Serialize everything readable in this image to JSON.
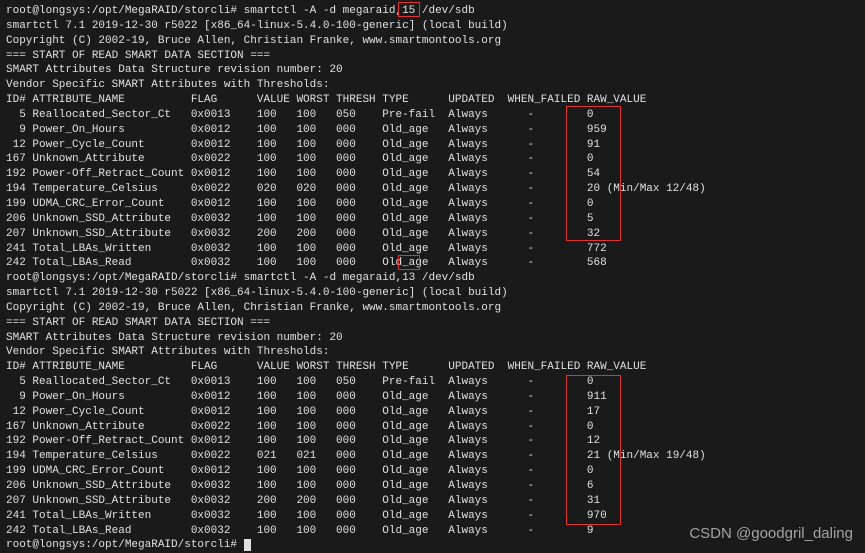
{
  "block1": {
    "cmd_prompt": "root@longsys:/opt/MegaRAID/storcli# ",
    "cmd": "smartctl -A -d megaraid,15 /dev/sdb",
    "version": "smartctl 7.1 2019-12-30 r5022 [x86_64-linux-5.4.0-100-generic] (local build)",
    "copyright": "Copyright (C) 2002-19, Bruce Allen, Christian Franke, www.smartmontools.org",
    "section_hdr": "=== START OF READ SMART DATA SECTION ===",
    "rev": "SMART Attributes Data Structure revision number: 20",
    "vendor": "Vendor Specific SMART Attributes with Thresholds:",
    "columns": {
      "id": "ID#",
      "attr": "ATTRIBUTE_NAME",
      "flag": "FLAG",
      "value": "VALUE",
      "worst": "WORST",
      "thresh": "THRESH",
      "type": "TYPE",
      "updated": "UPDATED",
      "when": "WHEN_FAILED",
      "raw": "RAW_VALUE"
    },
    "rows": [
      {
        "id": "  5",
        "name": "Reallocated_Sector_Ct",
        "flag": "0x0013",
        "value": "100",
        "worst": "100",
        "thresh": "050",
        "type": "Pre-fail",
        "updated": "Always",
        "when": "-",
        "raw": "0"
      },
      {
        "id": "  9",
        "name": "Power_On_Hours",
        "flag": "0x0012",
        "value": "100",
        "worst": "100",
        "thresh": "000",
        "type": "Old_age",
        "updated": "Always",
        "when": "-",
        "raw": "959"
      },
      {
        "id": " 12",
        "name": "Power_Cycle_Count",
        "flag": "0x0012",
        "value": "100",
        "worst": "100",
        "thresh": "000",
        "type": "Old_age",
        "updated": "Always",
        "when": "-",
        "raw": "91"
      },
      {
        "id": "167",
        "name": "Unknown_Attribute",
        "flag": "0x0022",
        "value": "100",
        "worst": "100",
        "thresh": "000",
        "type": "Old_age",
        "updated": "Always",
        "when": "-",
        "raw": "0"
      },
      {
        "id": "192",
        "name": "Power-Off_Retract_Count",
        "flag": "0x0012",
        "value": "100",
        "worst": "100",
        "thresh": "000",
        "type": "Old_age",
        "updated": "Always",
        "when": "-",
        "raw": "54"
      },
      {
        "id": "194",
        "name": "Temperature_Celsius",
        "flag": "0x0022",
        "value": "020",
        "worst": "020",
        "thresh": "000",
        "type": "Old_age",
        "updated": "Always",
        "when": "-",
        "raw": "20 (Min/Max 12/48)"
      },
      {
        "id": "199",
        "name": "UDMA_CRC_Error_Count",
        "flag": "0x0012",
        "value": "100",
        "worst": "100",
        "thresh": "000",
        "type": "Old_age",
        "updated": "Always",
        "when": "-",
        "raw": "0"
      },
      {
        "id": "206",
        "name": "Unknown_SSD_Attribute",
        "flag": "0x0032",
        "value": "100",
        "worst": "100",
        "thresh": "000",
        "type": "Old_age",
        "updated": "Always",
        "when": "-",
        "raw": "5"
      },
      {
        "id": "207",
        "name": "Unknown_SSD_Attribute",
        "flag": "0x0032",
        "value": "200",
        "worst": "200",
        "thresh": "000",
        "type": "Old_age",
        "updated": "Always",
        "when": "-",
        "raw": "32"
      },
      {
        "id": "241",
        "name": "Total_LBAs_Written",
        "flag": "0x0032",
        "value": "100",
        "worst": "100",
        "thresh": "000",
        "type": "Old_age",
        "updated": "Always",
        "when": "-",
        "raw": "772"
      },
      {
        "id": "242",
        "name": "Total_LBAs_Read",
        "flag": "0x0032",
        "value": "100",
        "worst": "100",
        "thresh": "000",
        "type": "Old_age",
        "updated": "Always",
        "when": "-",
        "raw": "568"
      }
    ]
  },
  "block2": {
    "cmd_prompt": "root@longsys:/opt/MegaRAID/storcli# ",
    "cmd": "smartctl -A -d megaraid,13 /dev/sdb",
    "version": "smartctl 7.1 2019-12-30 r5022 [x86_64-linux-5.4.0-100-generic] (local build)",
    "copyright": "Copyright (C) 2002-19, Bruce Allen, Christian Franke, www.smartmontools.org",
    "section_hdr": "=== START OF READ SMART DATA SECTION ===",
    "rev": "SMART Attributes Data Structure revision number: 20",
    "vendor": "Vendor Specific SMART Attributes with Thresholds:",
    "columns": {
      "id": "ID#",
      "attr": "ATTRIBUTE_NAME",
      "flag": "FLAG",
      "value": "VALUE",
      "worst": "WORST",
      "thresh": "THRESH",
      "type": "TYPE",
      "updated": "UPDATED",
      "when": "WHEN_FAILED",
      "raw": "RAW_VALUE"
    },
    "rows": [
      {
        "id": "  5",
        "name": "Reallocated_Sector_Ct",
        "flag": "0x0013",
        "value": "100",
        "worst": "100",
        "thresh": "050",
        "type": "Pre-fail",
        "updated": "Always",
        "when": "-",
        "raw": "0"
      },
      {
        "id": "  9",
        "name": "Power_On_Hours",
        "flag": "0x0012",
        "value": "100",
        "worst": "100",
        "thresh": "000",
        "type": "Old_age",
        "updated": "Always",
        "when": "-",
        "raw": "911"
      },
      {
        "id": " 12",
        "name": "Power_Cycle_Count",
        "flag": "0x0012",
        "value": "100",
        "worst": "100",
        "thresh": "000",
        "type": "Old_age",
        "updated": "Always",
        "when": "-",
        "raw": "17"
      },
      {
        "id": "167",
        "name": "Unknown_Attribute",
        "flag": "0x0022",
        "value": "100",
        "worst": "100",
        "thresh": "000",
        "type": "Old_age",
        "updated": "Always",
        "when": "-",
        "raw": "0"
      },
      {
        "id": "192",
        "name": "Power-Off_Retract_Count",
        "flag": "0x0012",
        "value": "100",
        "worst": "100",
        "thresh": "000",
        "type": "Old_age",
        "updated": "Always",
        "when": "-",
        "raw": "12"
      },
      {
        "id": "194",
        "name": "Temperature_Celsius",
        "flag": "0x0022",
        "value": "021",
        "worst": "021",
        "thresh": "000",
        "type": "Old_age",
        "updated": "Always",
        "when": "-",
        "raw": "21 (Min/Max 19/48)"
      },
      {
        "id": "199",
        "name": "UDMA_CRC_Error_Count",
        "flag": "0x0012",
        "value": "100",
        "worst": "100",
        "thresh": "000",
        "type": "Old_age",
        "updated": "Always",
        "when": "-",
        "raw": "0"
      },
      {
        "id": "206",
        "name": "Unknown_SSD_Attribute",
        "flag": "0x0032",
        "value": "100",
        "worst": "100",
        "thresh": "000",
        "type": "Old_age",
        "updated": "Always",
        "when": "-",
        "raw": "6"
      },
      {
        "id": "207",
        "name": "Unknown_SSD_Attribute",
        "flag": "0x0032",
        "value": "200",
        "worst": "200",
        "thresh": "000",
        "type": "Old_age",
        "updated": "Always",
        "when": "-",
        "raw": "31"
      },
      {
        "id": "241",
        "name": "Total_LBAs_Written",
        "flag": "0x0032",
        "value": "100",
        "worst": "100",
        "thresh": "000",
        "type": "Old_age",
        "updated": "Always",
        "when": "-",
        "raw": "970"
      },
      {
        "id": "242",
        "name": "Total_LBAs_Read",
        "flag": "0x0032",
        "value": "100",
        "worst": "100",
        "thresh": "000",
        "type": "Old_age",
        "updated": "Always",
        "when": "-",
        "raw": "9"
      }
    ]
  },
  "final_prompt": "root@longsys:/opt/MegaRAID/storcli# ",
  "watermark": "CSDN @goodgril_daling"
}
